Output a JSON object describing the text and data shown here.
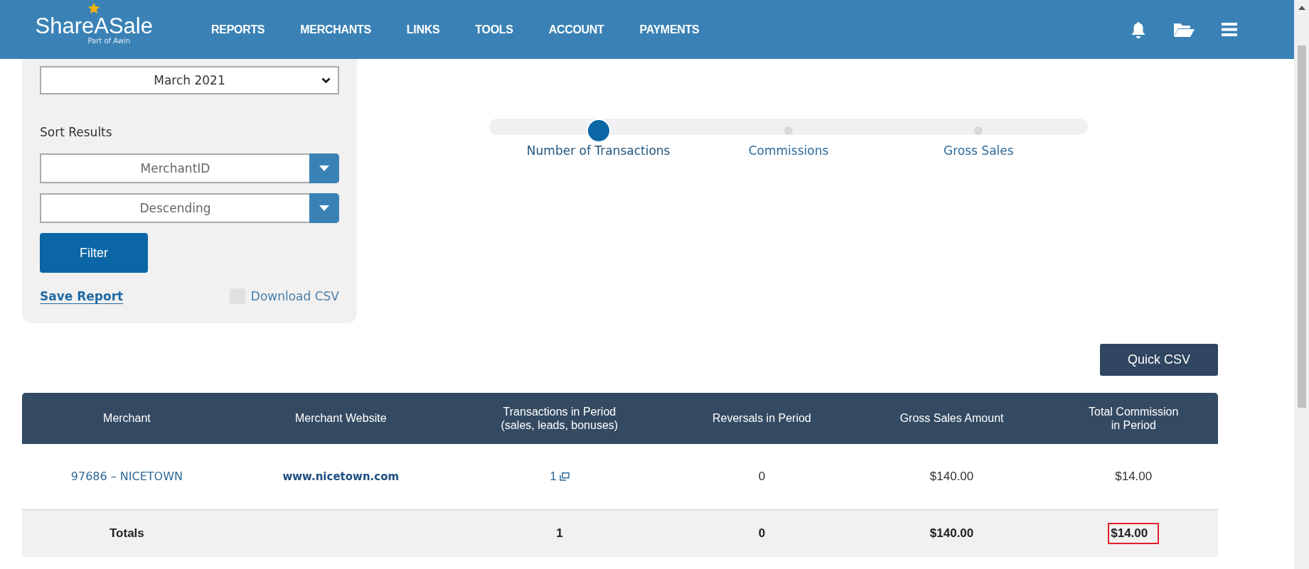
{
  "header": {
    "logo": "ShareASale",
    "logo_subtitle": "Part of Awin",
    "nav": [
      {
        "label": "REPORTS"
      },
      {
        "label": "MERCHANTS"
      },
      {
        "label": "LINKS"
      },
      {
        "label": "TOOLS"
      },
      {
        "label": "ACCOUNT"
      },
      {
        "label": "PAYMENTS"
      }
    ]
  },
  "filters": {
    "period": "March 2021",
    "sort_label": "Sort Results",
    "sort_by": "MerchantID",
    "sort_order": "Descending",
    "filter_button": "Filter",
    "save_report": "Save Report",
    "download_csv": {
      "label": "Download CSV",
      "checked": false
    }
  },
  "metric_steps": [
    {
      "label": "Number of Transactions",
      "selected": true
    },
    {
      "label": "Commissions",
      "selected": false
    },
    {
      "label": "Gross Sales",
      "selected": false
    }
  ],
  "quick_csv": "Quick CSV",
  "table": {
    "columns": [
      [
        "Merchant"
      ],
      [
        "Merchant Website"
      ],
      [
        "Transactions in Period",
        "(sales, leads, bonuses)"
      ],
      [
        "Reversals in Period"
      ],
      [
        "Gross Sales Amount"
      ],
      [
        "Total Commission",
        "in Period"
      ]
    ],
    "rows": [
      {
        "merchant": "97686 – NICETOWN",
        "website": "www.nicetown.com",
        "transactions": "1",
        "reversals": "0",
        "gross_sales": "$140.00",
        "commission": "$14.00"
      }
    ],
    "totals": {
      "label": "Totals",
      "transactions": "1",
      "reversals": "0",
      "gross_sales": "$140.00",
      "commission": {
        "text": "$14.00",
        "highlighted": true
      }
    }
  }
}
